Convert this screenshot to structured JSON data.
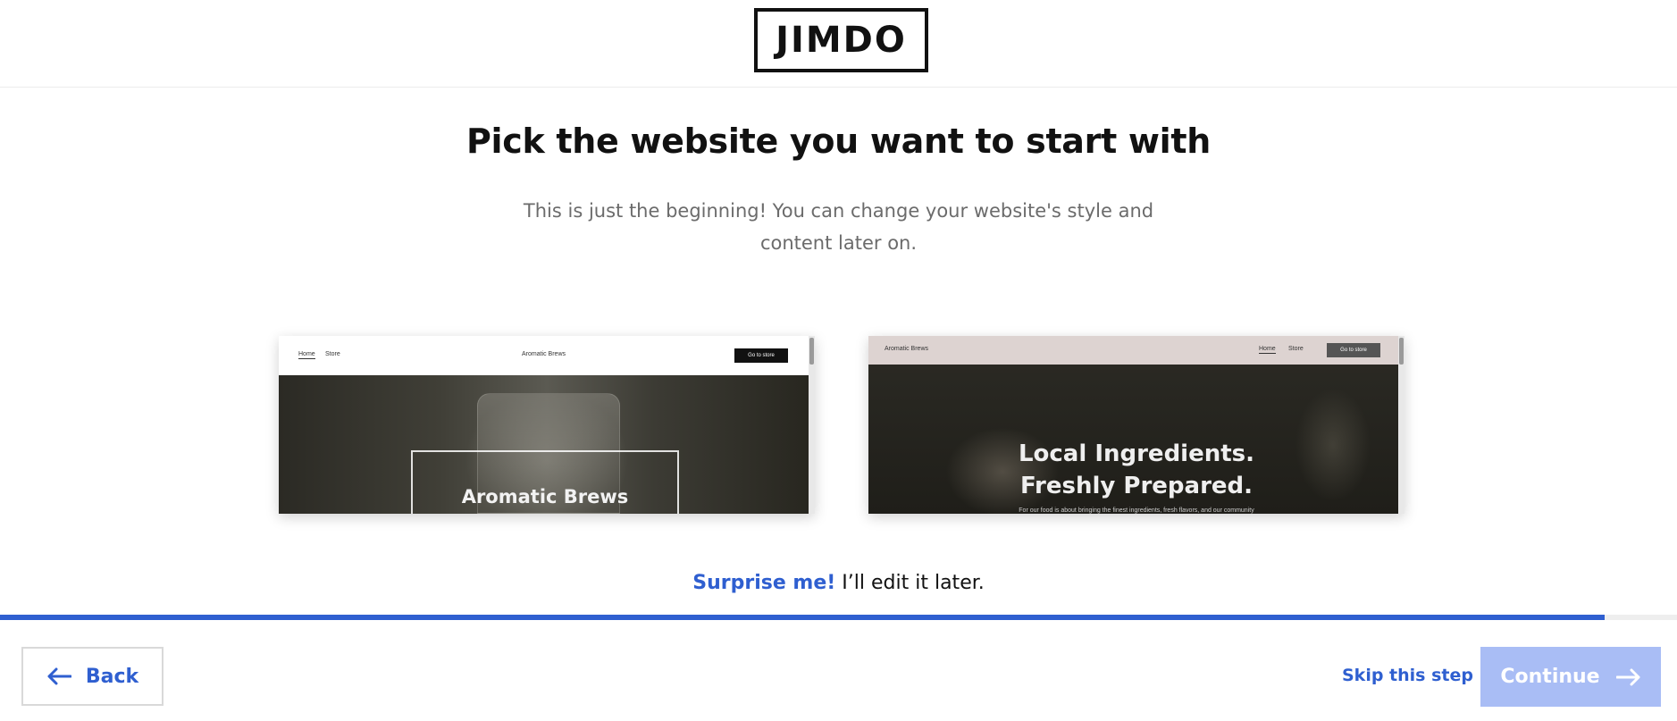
{
  "header": {
    "logo_text": "JIMDO"
  },
  "main": {
    "title": "Pick the website you want to start with",
    "subtitle": "This is just the beginning! You can change your website's style and content later on."
  },
  "templates": [
    {
      "nav_links": [
        "Home",
        "Store"
      ],
      "brand": "Aromatic Brews",
      "cta": "Go to store",
      "hero_title": "Aromatic Brews"
    },
    {
      "brand": "Aromatic Brews",
      "nav_links": [
        "Home",
        "Store"
      ],
      "cta": "Go to store",
      "hero_title_line1": "Local Ingredients.",
      "hero_title_line2": "Freshly Prepared.",
      "hero_subtitle": "For our food is about bringing the finest ingredients, fresh flavors, and our community"
    }
  ],
  "surprise": {
    "link": "Surprise me!",
    "text": " I’ll edit it later."
  },
  "progress": {
    "fraction": 0.957
  },
  "footer": {
    "back_label": "Back",
    "skip_label": "Skip this step",
    "continue_label": "Continue"
  },
  "icons": {
    "back": "arrow-left-icon",
    "continue": "arrow-right-icon"
  },
  "colors": {
    "accent": "#2f5fd0",
    "continue_disabled": "#a9bdf5"
  }
}
